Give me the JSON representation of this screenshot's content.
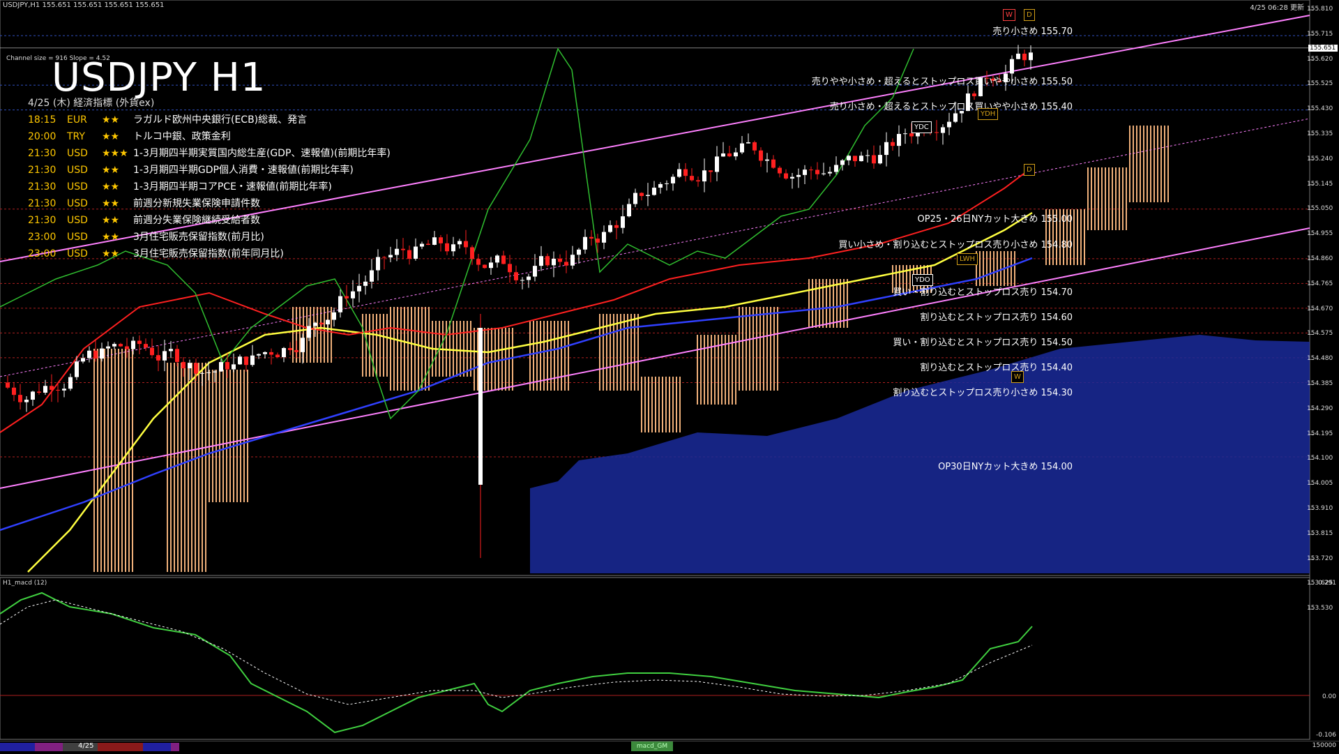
{
  "window": {
    "title": "USDJPY,H1  155.651 155.651 155.651 155.651",
    "time_label": "4/25 06:28 更新"
  },
  "chart": {
    "symbol_title": "USDJPY H1",
    "channel_info": "Channel size = 916 Slope = 4.52",
    "current_price": "155.651",
    "price_scale": [
      "155.810",
      "155.715",
      "155.620",
      "155.525",
      "155.430",
      "155.335",
      "155.240",
      "155.145",
      "155.050",
      "154.955",
      "154.860",
      "154.765",
      "154.670",
      "154.575",
      "154.480",
      "154.385",
      "154.290",
      "154.195",
      "154.100",
      "154.005",
      "153.910",
      "153.815",
      "153.720",
      "153.625",
      "153.530"
    ],
    "macd_title": "H1_macd (12)",
    "macd_scale": [
      "0.291",
      "0.00",
      "-0.106"
    ],
    "colors": {
      "bull_candle": "#ffffff",
      "bear_candle": "#ff2020",
      "channel": "#ff80ff",
      "kumo": "#f0b07a",
      "cloud_fill": "#1a2a9a",
      "ma_yellow": "#ffff40",
      "ma_blue": "#3040ff",
      "ma_red": "#ff2020",
      "chikou": "#30c030",
      "macd_line": "#40d040",
      "macd_signal": "#ffffff"
    }
  },
  "events": {
    "header": "4/25 (木) 経済指標 (外貨ex)",
    "rows": [
      {
        "time": "18:15",
        "cur": "EUR",
        "stars": "★★",
        "text": "ラガルド欧州中央銀行(ECB)総裁、発言"
      },
      {
        "time": "20:00",
        "cur": "TRY",
        "stars": "★★",
        "text": "トルコ中銀、政策金利"
      },
      {
        "time": "21:30",
        "cur": "USD",
        "stars": "★★★",
        "text": "1-3月期四半期実質国内総生産(GDP、速報値)(前期比年率)"
      },
      {
        "time": "21:30",
        "cur": "USD",
        "stars": "★★",
        "text": "1-3月期四半期GDP個人消費・速報値(前期比年率)"
      },
      {
        "time": "21:30",
        "cur": "USD",
        "stars": "★★",
        "text": "1-3月期四半期コアPCE・速報値(前期比年率)"
      },
      {
        "time": "21:30",
        "cur": "USD",
        "stars": "★★",
        "text": "前週分新規失業保険申請件数"
      },
      {
        "time": "21:30",
        "cur": "USD",
        "stars": "★★",
        "text": "前週分失業保険継続受給者数"
      },
      {
        "time": "23:00",
        "cur": "USD",
        "stars": "★★",
        "text": "3月住宅販売保留指数(前月比)"
      },
      {
        "time": "23:00",
        "cur": "USD",
        "stars": "★★",
        "text": "3月住宅販売保留指数(前年同月比)"
      }
    ]
  },
  "levels": [
    {
      "text": "売り小さめ 155.70"
    },
    {
      "text": "売りやや小さめ・超えるとストップロス買いやや小さめ 155.50"
    },
    {
      "text": "売り小さめ・超えるとストップロス買いやや小さめ 155.40"
    },
    {
      "text": "OP25・26日NYカット大きめ 155.00"
    },
    {
      "text": "買い小さめ・割り込むとストップロス売り小さめ 154.80"
    },
    {
      "text": "買い・割り込むとストップロス売り 154.70"
    },
    {
      "text": "割り込むとストップロス売り 154.60"
    },
    {
      "text": "買い・割り込むとストップロス売り 154.50"
    },
    {
      "text": "割り込むとストップロス売り 154.40"
    },
    {
      "text": "割り込むとストップロス売り小さめ 154.30"
    },
    {
      "text": "OP30日NYカット大きめ 154.00"
    }
  ],
  "tags": {
    "ydc_top": "YDC",
    "ydh": "YDH",
    "d_upper": "D",
    "d_lower": "D",
    "lwh": "LWH",
    "ydo": "YDO",
    "w": "W",
    "top_w": "W",
    "top_d": "D"
  },
  "bottom": {
    "date": "4/25",
    "tab": "macd_GM",
    "right": "150000"
  }
}
